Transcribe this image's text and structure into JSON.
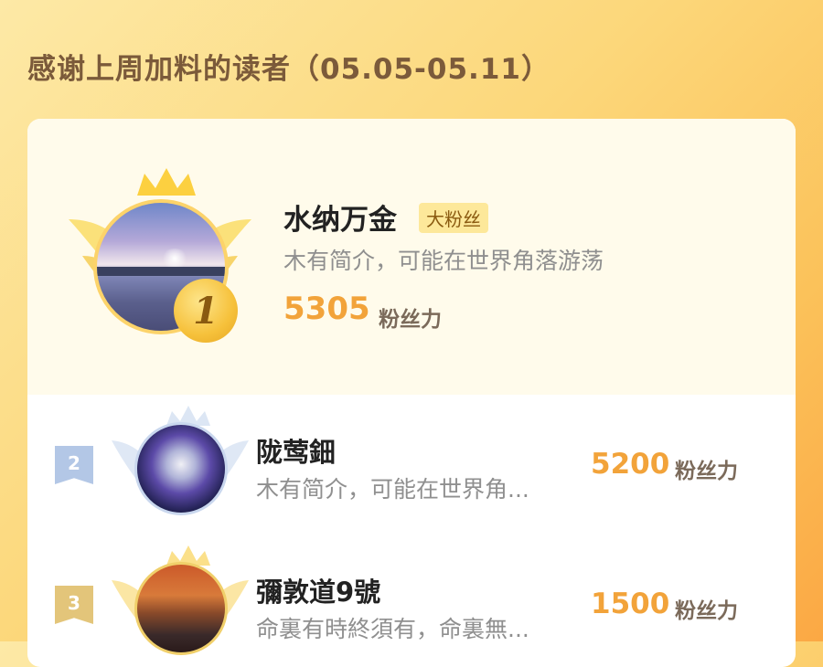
{
  "header": {
    "title": "感谢上周加料的读者（05.05-05.11）"
  },
  "top_reader": {
    "rank": "1",
    "name": "水纳万金",
    "tag": "大粉丝",
    "bio": "木有简介，可能在世界角落游荡",
    "score": "5305",
    "unit": "粉丝力"
  },
  "readers": [
    {
      "rank": "2",
      "name": "陇莺鈿",
      "bio": "木有简介，可能在世界角...",
      "score": "5200",
      "unit": "粉丝力"
    },
    {
      "rank": "3",
      "name": "彌敦道9號",
      "bio": "命裏有時終須有，命裏無...",
      "score": "1500",
      "unit": "粉丝力"
    }
  ],
  "colors": {
    "accent": "#f2a33a",
    "gold": "#f6c13b",
    "silver": "#b3c7e6",
    "bronze": "#e3c57a"
  },
  "icons": [
    "crown-icon",
    "wings-icon",
    "rank-medal-icon",
    "rank-ribbon-icon"
  ]
}
